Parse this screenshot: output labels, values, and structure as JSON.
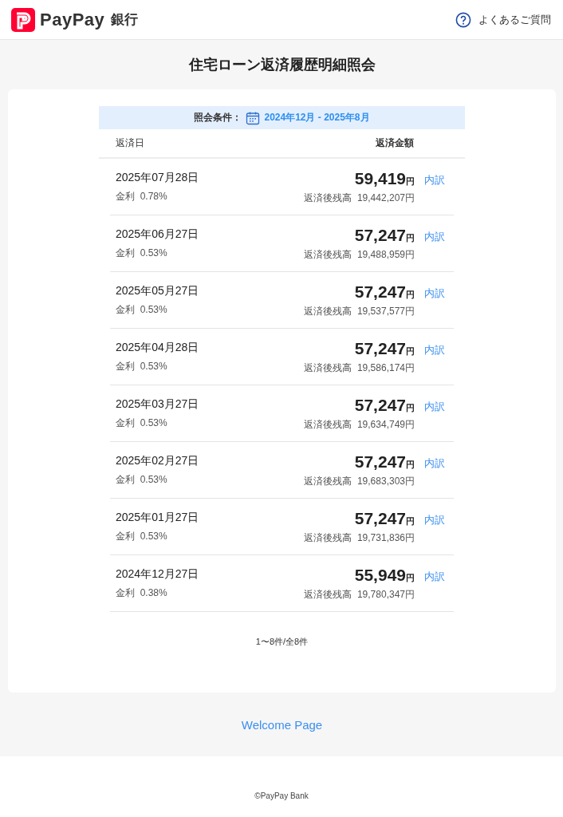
{
  "header": {
    "logo_text": "PayPay",
    "logo_suffix": "銀行",
    "help_link": "よくあるご質問"
  },
  "title": "住宅ローン返済履歴明細照会",
  "filter": {
    "label": "照会条件：",
    "range": "2024年12月 - 2025年8月"
  },
  "columns": [
    "返済日",
    "返済金額"
  ],
  "rows": [
    {
      "date": "2025年07月28日",
      "rate_label": "金利",
      "rate": "0.78%",
      "amount": "59,419",
      "currency": "円",
      "balance_label": "返済後残高",
      "balance": "19,442,207円",
      "detail_link": "内訳"
    },
    {
      "date": "2025年06月27日",
      "rate_label": "金利",
      "rate": "0.53%",
      "amount": "57,247",
      "currency": "円",
      "balance_label": "返済後残高",
      "balance": "19,488,959円",
      "detail_link": "内訳"
    },
    {
      "date": "2025年05月27日",
      "rate_label": "金利",
      "rate": "0.53%",
      "amount": "57,247",
      "currency": "円",
      "balance_label": "返済後残高",
      "balance": "19,537,577円",
      "detail_link": "内訳"
    },
    {
      "date": "2025年04月28日",
      "rate_label": "金利",
      "rate": "0.53%",
      "amount": "57,247",
      "currency": "円",
      "balance_label": "返済後残高",
      "balance": "19,586,174円",
      "detail_link": "内訳"
    },
    {
      "date": "2025年03月27日",
      "rate_label": "金利",
      "rate": "0.53%",
      "amount": "57,247",
      "currency": "円",
      "balance_label": "返済後残高",
      "balance": "19,634,749円",
      "detail_link": "内訳"
    },
    {
      "date": "2025年02月27日",
      "rate_label": "金利",
      "rate": "0.53%",
      "amount": "57,247",
      "currency": "円",
      "balance_label": "返済後残高",
      "balance": "19,683,303円",
      "detail_link": "内訳"
    },
    {
      "date": "2025年01月27日",
      "rate_label": "金利",
      "rate": "0.53%",
      "amount": "57,247",
      "currency": "円",
      "balance_label": "返済後残高",
      "balance": "19,731,836円",
      "detail_link": "内訳"
    },
    {
      "date": "2024年12月27日",
      "rate_label": "金利",
      "rate": "0.38%",
      "amount": "55,949",
      "currency": "円",
      "balance_label": "返済後残高",
      "balance": "19,780,347円",
      "detail_link": "内訳"
    }
  ],
  "pagination": "1〜8件/全8件",
  "nav_link": "Welcome Page",
  "copyright": "©PayPay Bank"
}
